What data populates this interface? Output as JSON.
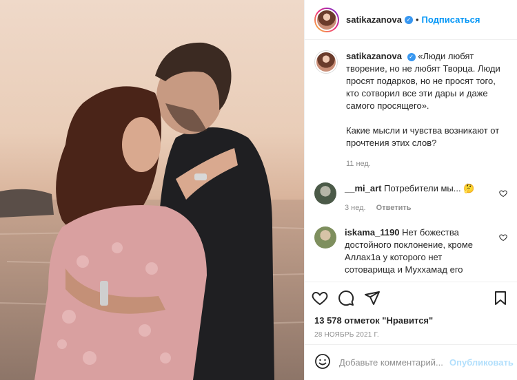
{
  "post": {
    "username": "satikazanova",
    "follow_label": "Подписаться",
    "dot": "•",
    "caption_text": "«Люди любят творение, но не любят Творца. Люди просят подарков, но не просят того, кто сотворил все эти дары и даже самого просящего».",
    "caption_text2": "Какие мысли и чувства возникают от прочтения этих слов?",
    "caption_age": "11 нед."
  },
  "comments": [
    {
      "username": "__mi_art",
      "text": "Потребители мы... 🤔",
      "age": "3 нед.",
      "reply_label": "Ответить"
    },
    {
      "username": "iskama_1190",
      "text": "Нет божества достойного поклонение, кроме Аллах1а у которого нет сотоварища и Мухxамад его"
    }
  ],
  "stats": {
    "likes": "13 578 отметок \"Нравится\"",
    "date": "28 НОЯБРЬ 2021 Г."
  },
  "add_comment": {
    "placeholder": "Добавьте комментарий...",
    "publish_label": "Опубликовать"
  },
  "icons": [
    "heart-icon",
    "comment-icon",
    "share-icon",
    "bookmark-icon",
    "emoji-icon",
    "verified-icon"
  ],
  "colors": {
    "link": "#0095f6",
    "verified": "#3897f0",
    "muted": "#8e8e8e"
  }
}
